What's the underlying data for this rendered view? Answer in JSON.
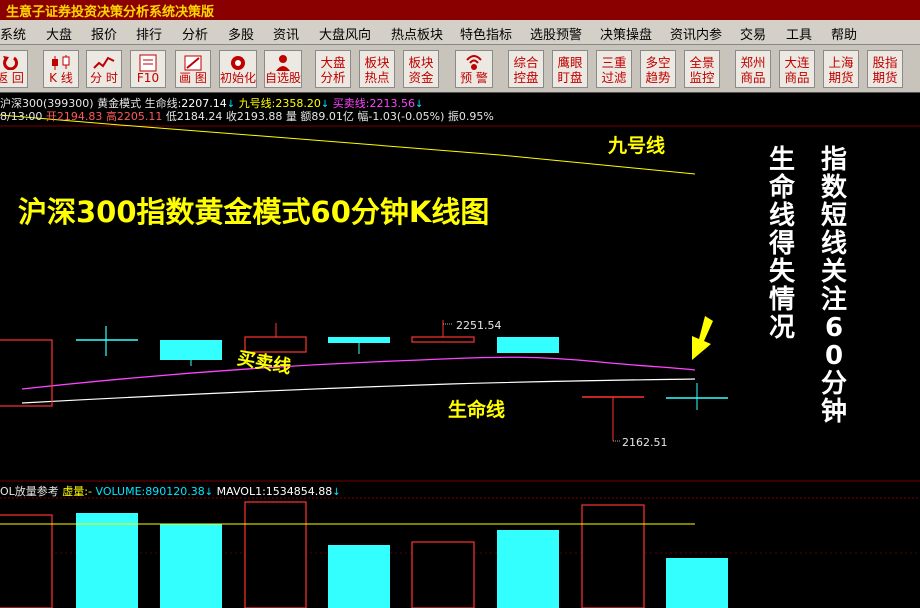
{
  "window": {
    "title": "生意子证券投资决策分析系统决策版"
  },
  "menu": [
    "系统",
    "大盘",
    "报价",
    "排行",
    "分析",
    "多股",
    "资讯",
    "大盘风向",
    "热点板块",
    "特色指标",
    "选股预警",
    "决策操盘",
    "资讯内参",
    "交易",
    "工具",
    "帮助"
  ],
  "toolbar": [
    {
      "label": "返 回",
      "icon": "back-icon"
    },
    {
      "label": "K 线",
      "icon": "candlestick-icon"
    },
    {
      "label": "分 时",
      "icon": "intraday-icon"
    },
    {
      "label": "F10",
      "icon": "f10-icon"
    },
    {
      "label": "画 图",
      "icon": "draw-icon"
    },
    {
      "label": "初始化",
      "icon": "reset-icon"
    },
    {
      "label": "自选股",
      "icon": "watchlist-icon"
    },
    {
      "label": "大盘\n分析"
    },
    {
      "label": "板块\n热点"
    },
    {
      "label": "板块\n资金"
    },
    {
      "label": "预 警",
      "icon": "alarm-icon"
    },
    {
      "label": "综合\n控盘"
    },
    {
      "label": "鹰眼\n盯盘"
    },
    {
      "label": "三重\n过滤"
    },
    {
      "label": "多空\n趋势"
    },
    {
      "label": "全景\n监控"
    },
    {
      "label": "郑州\n商品"
    },
    {
      "label": "大连\n商品"
    },
    {
      "label": "上海\n期货"
    },
    {
      "label": "股指\n期货"
    }
  ],
  "info": {
    "title_prefix": "沪深300(399300) 黄金模式",
    "shengming_label": "生命线:",
    "shengming_value": "2207.14",
    "jiuhao_label": "九号线:",
    "jiuhao_value": "2358.20",
    "maimai_label": "买卖线:",
    "maimai_value": "2213.56",
    "bar_time": "8/13:00",
    "open": "开2194.83",
    "high": "高2205.11",
    "low": "低2184.24",
    "close": "收2193.88",
    "amount": "量 额89.01亿",
    "change": "幅-1.03(-0.05%)",
    "amplitude": "振0.95%",
    "vol_title": "OL放量参考",
    "vol_xu": "虚量:-",
    "volume": "VOLUME:890120.38",
    "mavol": "MAVOL1:1534854.88"
  },
  "annotations": {
    "main_title": "沪深300指数黄金模式60分钟K线图",
    "jiuhao": "九号线",
    "maimai": "买卖线",
    "shengming": "生命线",
    "side1": "生命线得失情况",
    "side2": "指数短线关注60分钟",
    "price_high": "2251.54",
    "price_low": "2162.51"
  },
  "colors": {
    "up": "#ff3333",
    "down": "#33ffff",
    "jiuhao": "#ffff00",
    "maimai": "#ff44ff",
    "shengming": "#ffffff",
    "annotation": "#ffff00"
  }
}
